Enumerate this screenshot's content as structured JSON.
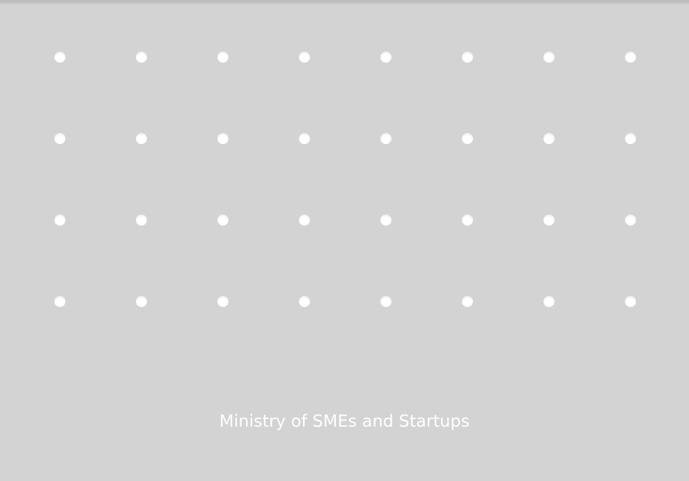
{
  "screen": {
    "background_color": "#d3d3d3",
    "dot_color": "#ffffff",
    "label_color": "#ffffff"
  },
  "pegboard": {
    "rows": 4,
    "columns": 8
  },
  "footer": {
    "organization_name": "Ministry of SMEs and Startups"
  }
}
